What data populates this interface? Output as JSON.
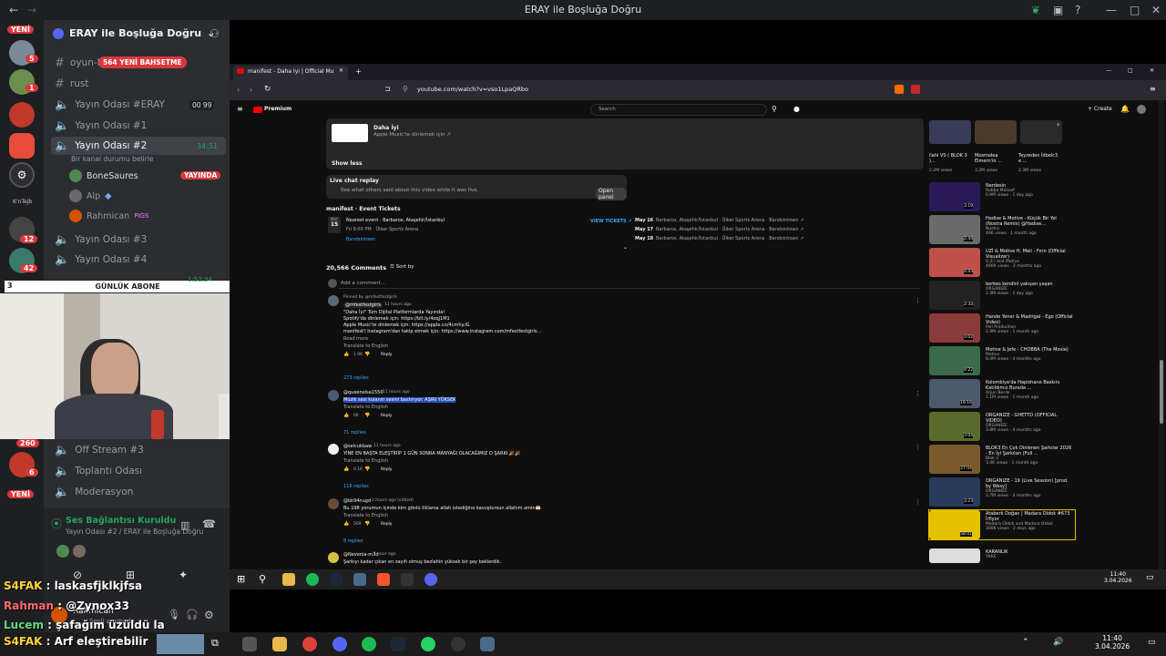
{
  "window": {
    "title": "ERAY ile Boşluğa Doğru"
  },
  "servers": {
    "new_top": "YENİ",
    "new_bottom": "YENİ",
    "badges": [
      "5",
      "1",
      "12",
      "42",
      "260",
      "6"
    ],
    "kn_label": "K'nTejb"
  },
  "server_header": {
    "name": "ERAY ile Boşluğa Doğru"
  },
  "channels": [
    {
      "name": "oyun-k",
      "badge": "564 YENİ BAHSETME"
    },
    {
      "name": "rust"
    },
    {
      "name": "Yayın Odası #ERAY",
      "counts": "00 99"
    },
    {
      "name": "Yayın Odası #1"
    },
    {
      "name": "Yayın Odası #2",
      "time": "34:51",
      "status": "Bir kanal durumu belirle"
    },
    {
      "name": "Yayın Odası #3"
    },
    {
      "name": "Yayın Odası #4"
    },
    {
      "name": "Off Stream #3"
    },
    {
      "name": "Toplantı Odası"
    },
    {
      "name": "Moderasyon"
    }
  ],
  "voice_users": [
    {
      "name": "BoneSaures",
      "tag": "YAYINDA"
    },
    {
      "name": "Alp"
    },
    {
      "name": "Rahmican",
      "tag": "PIGS"
    }
  ],
  "abone": {
    "left": "3",
    "label": "GÜNLÜK ABONE",
    "right": "5",
    "time": "1:52:34"
  },
  "voice_panel": {
    "status": "Ses Bağlantısı Kuruldu",
    "channel": "Yayın Odası #2 / ERAY ile Boşluğa Doğru",
    "user": "Rahmican",
    "user_status": "Sesli aramada"
  },
  "chat": [
    {
      "user": "S4FAK",
      "text": "laskasfjklkjfsa"
    },
    {
      "user": "Rahman",
      "text": "@Zynox33"
    },
    {
      "user": "Lucem",
      "text": "şafağım üzüldü la"
    },
    {
      "user": "S4FAK",
      "text": "Arf eleştirebilir"
    }
  ],
  "browser": {
    "tab_title": "manifest - Daha İyi | Official Mu",
    "url": "youtube.com/watch?v=vso1LpaQRbo",
    "yt_logo": "Premium",
    "search_placeholder": "Search",
    "create": "+ Create"
  },
  "youtube": {
    "desc_song": "Daha İyi",
    "desc_song_sub": "Apple Music'te dinlemek için ↗",
    "show_less": "Show less",
    "live_chat_title": "Live chat replay",
    "live_chat_sub": "See what others said about this video while it was live.",
    "open_panel": "Open panel",
    "tickets_title": "manifest · Event Tickets",
    "event_month": "MAY",
    "event_day": "15",
    "event_name": "Nearest event · Barbaros, Ataşehir/İstanbul",
    "event_time": "Fri 9:00 PM · Ülker Sports Arena",
    "event_seller": "Bandsintown",
    "view_tickets": "VIEW TICKETS ↗",
    "events": [
      {
        "date": "May 16",
        "place": "Barbaros, Ataşehir/İstanbul · Ülker Sports Arena · Bandsintown ↗"
      },
      {
        "date": "May 17",
        "place": "Barbaros, Ataşehir/İstanbul · Ülker Sports Arena · Bandsintown ↗"
      },
      {
        "date": "May 18",
        "place": "Barbaros, Ataşehir/İstanbul · Ülker Sports Arena · Bandsintown ↗"
      }
    ],
    "comments_count": "20,566 Comments",
    "sort_by": "Sort by",
    "add_comment": "Add a comment...",
    "comments": [
      {
        "pinned": "Pinned by @mfestfestgirls",
        "user": "@mfestfestgirls",
        "time": "11 hours ago",
        "lines": [
          "\"Daha İyi\" Tüm Dijital Platformlarda Yayında!",
          "Spotify'da dinlemek için: https://bit.ly/4oqj1M1",
          "Apple Music'te dinlemek için: https://apple.co/4cmhy.lG",
          "manifest'i Instagram'dan takip etmek için: https://www.instagram.com/mfestfestgirls..."
        ],
        "read_more": "Read more",
        "translate": "Translate to English",
        "likes": "1.9K",
        "reply": "Reply",
        "replies": "273 replies"
      },
      {
        "user": "@queenelsa1550",
        "time": "11 hours ago",
        "lines": [
          "Müzik sesi kulanın sesini bastırıyor. AŞIRI YÜKSEK"
        ],
        "translate": "Translate to English",
        "likes": "6K",
        "reply": "Reply",
        "replies": "71 replies"
      },
      {
        "user": "@selcukbaw",
        "time": "11 hours ago",
        "lines": [
          "YİNE EN BAŞTA ELEŞTİRİP 1 GÜN SONRA MANYAĞI OLACAĞIMIZ O ŞARKI 🎉🎉"
        ],
        "translate": "Translate to English",
        "likes": "6.1K",
        "reply": "Reply",
        "replies": "116 replies"
      },
      {
        "user": "@bk94nugd",
        "time": "2 hours ago (edited)",
        "lines": [
          "Bu 198 yorumun içinde kim gönlü tiklarsa allah istediğine kavuştursun allahım amin🤲🏻"
        ],
        "translate": "Translate to English",
        "likes": "569",
        "reply": "Reply",
        "replies": "8 replies"
      },
      {
        "user": "@Nevenia-m3d",
        "time": "1 hour ago",
        "lines": [
          "Şarkıyı kadar çıkan en zayıfı olmuş bezlahin yüksek bir şey beklerdik."
        ]
      }
    ],
    "recs": [
      {
        "title": "Nerdesin",
        "channel": "Rubba Monsef",
        "meta": "6.9M views · 1 day ago",
        "dur": "3:19"
      },
      {
        "title": "Hadise & Motive - Küçük Bir Yol (Nostra Remix) @Hadise...",
        "channel": "Nostra",
        "meta": "49K views · 1 month ago",
        "dur": "2:44"
      },
      {
        "title": "UZİ & Motive ft. Mali - Fırın (Official Visualizer)",
        "channel": "U.Z.I and Motive",
        "meta": "490K views · 2 months ago",
        "dur": "4:43"
      },
      {
        "title": "berkes kendini yakışan yaşan",
        "channel": "ORGANIZE",
        "meta": "2.4M views · 1 day ago",
        "dur": "2:33"
      },
      {
        "title": "Hande Yener & Madrigal - Ego (Official Video)",
        "channel": "Poll Production",
        "meta": "1.9M views · 1 month ago",
        "dur": "3:02"
      },
      {
        "title": "Motive & Jefe - CHOBBA (The Movie)",
        "channel": "Motive",
        "meta": "8.4M views · 4 months ago",
        "dur": "4:22"
      },
      {
        "title": "Kolombiya'da Hapishane Baskını Katıldımız Burada ...",
        "channel": "Arjun Berde",
        "meta": "1.1M views · 1 month ago",
        "dur": "19:16"
      },
      {
        "title": "ORGANIZE - GHETTO (OFFICIAL VIDEO)",
        "channel": "ORGANIZE",
        "meta": "3.8M views · 4 months ago",
        "dur": "3:04"
      },
      {
        "title": "BLOK3 En Çok Dinlenen Şarkılar 2026 - En İyi Şarkıları (Full ...",
        "channel": "Blok 3",
        "meta": "3.4K views · 1 month ago",
        "dur": "37:04"
      },
      {
        "title": "ORGANIZE - 19 (Live Session) [prod. by Wesy]",
        "channel": "ORGANIZE",
        "meta": "3.7M views · 4 months ago",
        "dur": "3:23"
      },
      {
        "title": "Ataberk Doğan | Madara Oldok #673 İrfiyor",
        "channel": "Madara Oldok and Madara Oldok",
        "meta": "300K views · 2 days ago",
        "dur": "58:01"
      },
      {
        "title": "KARANLIK",
        "channel": "YKKE",
        "meta": "",
        "dur": ""
      }
    ],
    "top_recs": [
      {
        "title": "ilahi VS ( BLOK 3 )...",
        "meta": "2.2M views"
      },
      {
        "title": "Mosmolea Elmern'in ...",
        "meta": "3.2M views"
      },
      {
        "title": "Teyzeden İdbelc3 e ...",
        "meta": "2.3M views"
      }
    ]
  },
  "taskbar_inner": {
    "time": "11:40",
    "date": "3.04.2026"
  },
  "taskbar": {
    "time": "11:40",
    "date": "3.04.2026"
  },
  "colors": {
    "discord_bg": "#2b2d31",
    "discord_dark": "#1e1f22",
    "yt_bg": "#0f0f0f",
    "accent_red": "#da373c",
    "green": "#23a55a"
  }
}
